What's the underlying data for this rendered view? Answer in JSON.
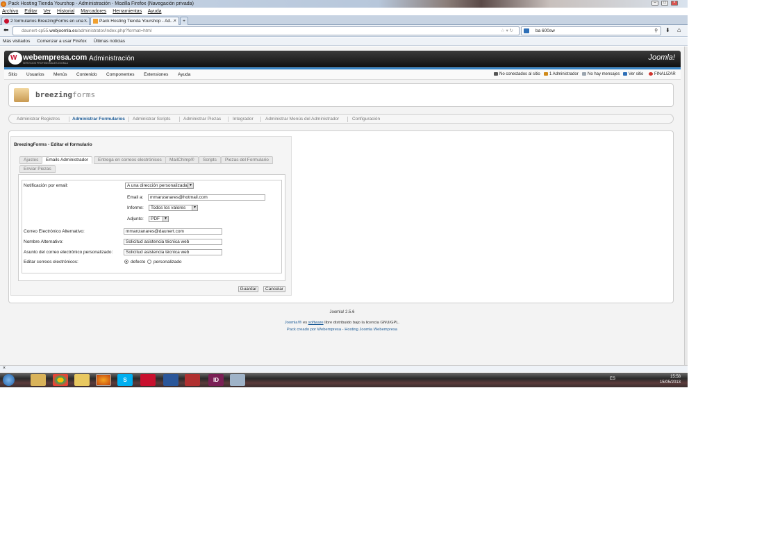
{
  "window": {
    "title": "Pack Hosting Tienda Yourshop - Administración - Mozilla Firefox (Navegación privada)"
  },
  "menubar": [
    "Archivo",
    "Editar",
    "Ver",
    "Historial",
    "Marcadores",
    "Herramientas",
    "Ayuda"
  ],
  "tabs": [
    {
      "label": "2 formularios BreezingForms en una ..."
    },
    {
      "label": "Pack Hosting Tienda Yourshop - Ad..."
    }
  ],
  "url": {
    "prefix": "daunert-cp55.",
    "domain": "webjoomla.es",
    "path": "/administrator/index.php?format=html"
  },
  "search": {
    "value": "ba 600sw"
  },
  "bookmarks": [
    "Más visitados",
    "Comenzar a usar Firefox",
    "Últimas noticias"
  ],
  "header": {
    "brand": "webempresa.com",
    "brand_sub": "SERVICIOS PROFESIONALES JOOMLA",
    "title": "Administración",
    "joomla": "Joomla!"
  },
  "nav": [
    "Sitio",
    "Usuarios",
    "Menús",
    "Contenido",
    "Componentes",
    "Extensiones",
    "Ayuda"
  ],
  "status": [
    {
      "label": "No conectados al sitio",
      "color": "#555555"
    },
    {
      "label": "1 Administrador",
      "color": "#d08a1a"
    },
    {
      "label": "No hay mensajes",
      "color": "#9aa4ae"
    },
    {
      "label": "Ver sitio",
      "color": "#2e6fb7"
    },
    {
      "label": "FINALIZAR",
      "color": "#d0342c"
    }
  ],
  "bf_logo": {
    "a": "breezing",
    "b": "forms"
  },
  "subnav": [
    "Administrar Registros",
    "Administrar Formularios",
    "Administrar Scripts",
    "Administrar Piezas",
    "Integrador",
    "Administrar Menús del Administrador",
    "Configuración"
  ],
  "form": {
    "title": "BreezingForms - Editar el formulario",
    "tabs": [
      "Ajustes",
      "Emails Administrador",
      "Entrega en correos electrónicos",
      "MailChimp®",
      "Scripts",
      "Piezas del Formulario",
      "Enviar Piezas"
    ],
    "notificacion_label": "Notificación por email:",
    "notificacion_value": "A una dirección personalizada",
    "email_label": "Email a:",
    "email_value": "mmanzanares@hotmail.com",
    "informe_label": "Informe:",
    "informe_value": "Todos los valores",
    "adjunto_label": "Adjunto:",
    "adjunto_value": "PDF",
    "alt_email_label": "Correo Electrónico Alternativo:",
    "alt_email_value": "mmanzanares@daunert.com",
    "alt_name_label": "Nombre Alternativo:",
    "alt_name_value": "Solicitud asistencia técnica web",
    "subject_label": "Asunto del correo electrónico personalizado:",
    "subject_value": "Solicitud asistencia técnica web",
    "edit_label": "Editar correos electrónicos:",
    "radio_default": "defecto",
    "radio_custom": "personalizado",
    "save": "Guardar",
    "cancel": "Cancelar"
  },
  "footer": {
    "version": "Joomla! 2.5.6",
    "joomla": "Joomla!®",
    "es": "es",
    "software": "software",
    "license": "libre distribuido bajo la licencia GNU/GPL.",
    "pack": "Pack creado por Webempresa - Hosting Joomla Webempresa"
  },
  "taskbar": {
    "lang": "ES",
    "time": "15:58",
    "date": "15/05/2013"
  }
}
